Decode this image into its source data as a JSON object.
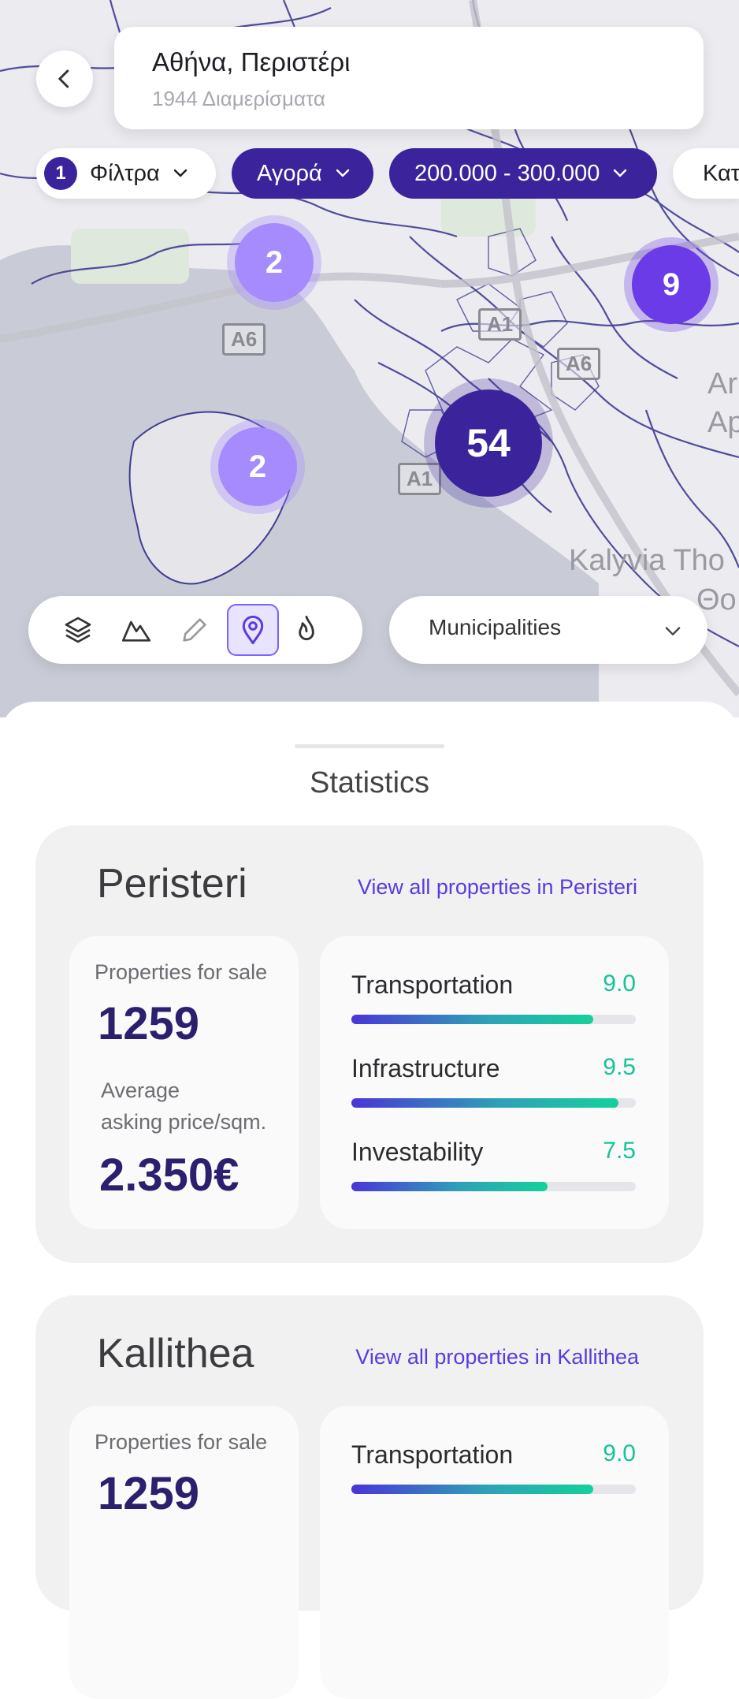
{
  "header": {
    "location_title": "Αθήνα, Περιστέρι",
    "location_subtitle": "1944 Διαμερίσματα"
  },
  "filters": {
    "count_badge": "1",
    "filters_label": "Φίλτρα",
    "transaction_label": "Αγορά",
    "price_label": "200.000 - 300.000",
    "category_label": "Κατ"
  },
  "map": {
    "labels": [
      "Kalyvia Tho",
      "Θο",
      "Ar",
      "Ap"
    ],
    "road_tags": [
      "A6",
      "A1",
      "A6",
      "A1"
    ],
    "clusters": [
      {
        "count": "2"
      },
      {
        "count": "9"
      },
      {
        "count": "2"
      },
      {
        "count": "54"
      }
    ]
  },
  "tools": {
    "items": [
      {
        "icon": "layers-icon"
      },
      {
        "icon": "terrain-icon"
      },
      {
        "icon": "pencil-icon"
      },
      {
        "icon": "pin-icon",
        "active": true
      },
      {
        "icon": "flame-icon"
      }
    ],
    "dropdown_label": "Municipalities"
  },
  "stats": {
    "title": "Statistics",
    "areas": [
      {
        "name": "Peristeri",
        "link": "View all properties in Peristeri",
        "properties_label": "Properties for sale",
        "properties_value": "1259",
        "price_label_1": "Average",
        "price_label_2": "asking price/sqm.",
        "price_value": "2.350€",
        "scores": [
          {
            "name": "Transportation",
            "value": "9.0",
            "fraction": 0.85
          },
          {
            "name": "Infrastructure",
            "value": "9.5",
            "fraction": 0.94
          },
          {
            "name": "Investability",
            "value": "7.5",
            "fraction": 0.69
          }
        ]
      },
      {
        "name": "Kallithea",
        "link": "View all properties in Kallithea",
        "properties_label": "Properties for sale",
        "properties_value": "1259",
        "scores": [
          {
            "name": "Transportation",
            "value": "9.0",
            "fraction": 0.85
          }
        ]
      }
    ]
  },
  "colors": {
    "brand_dark": "#3b249b",
    "brand_light": "#a68bff",
    "link": "#5b3bdc",
    "score_value": "#14c39a"
  }
}
